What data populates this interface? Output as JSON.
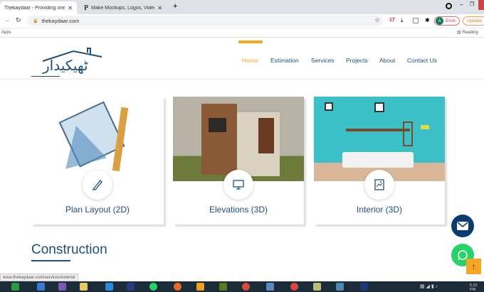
{
  "browser": {
    "tabs": [
      {
        "title": "Thekaydaar - Providing one sto"
      },
      {
        "title": "Make Mockups, Logos, Videos a"
      }
    ],
    "new_tab": "+",
    "url": "thekaydaar.com",
    "apps_label": "Apps",
    "reading_label": "Reading",
    "profile_initial": "A",
    "error_label": "Error",
    "update_label": "Update",
    "status_url": "www.thekaydaar.com/services/exterior"
  },
  "site": {
    "logo_text": "ٹھیکیدار",
    "nav": [
      {
        "label": "Home",
        "active": true
      },
      {
        "label": "Estimation"
      },
      {
        "label": "Services"
      },
      {
        "label": "Projects"
      },
      {
        "label": "About"
      },
      {
        "label": "Contact Us"
      }
    ],
    "cards": [
      {
        "label": "Plan Layout (2D)",
        "icon": "pencil-icon"
      },
      {
        "label": "Elevations (3D)",
        "icon": "monitor-icon"
      },
      {
        "label": "Interior (3D)",
        "icon": "image-icon"
      }
    ],
    "section_title": "Construction"
  },
  "colors": {
    "brand": "#1f4e79",
    "accent": "#f5a623",
    "mail": "#0d3b6e",
    "whatsapp": "#25d366"
  },
  "taskbar": {
    "time": "5:22 PM"
  }
}
